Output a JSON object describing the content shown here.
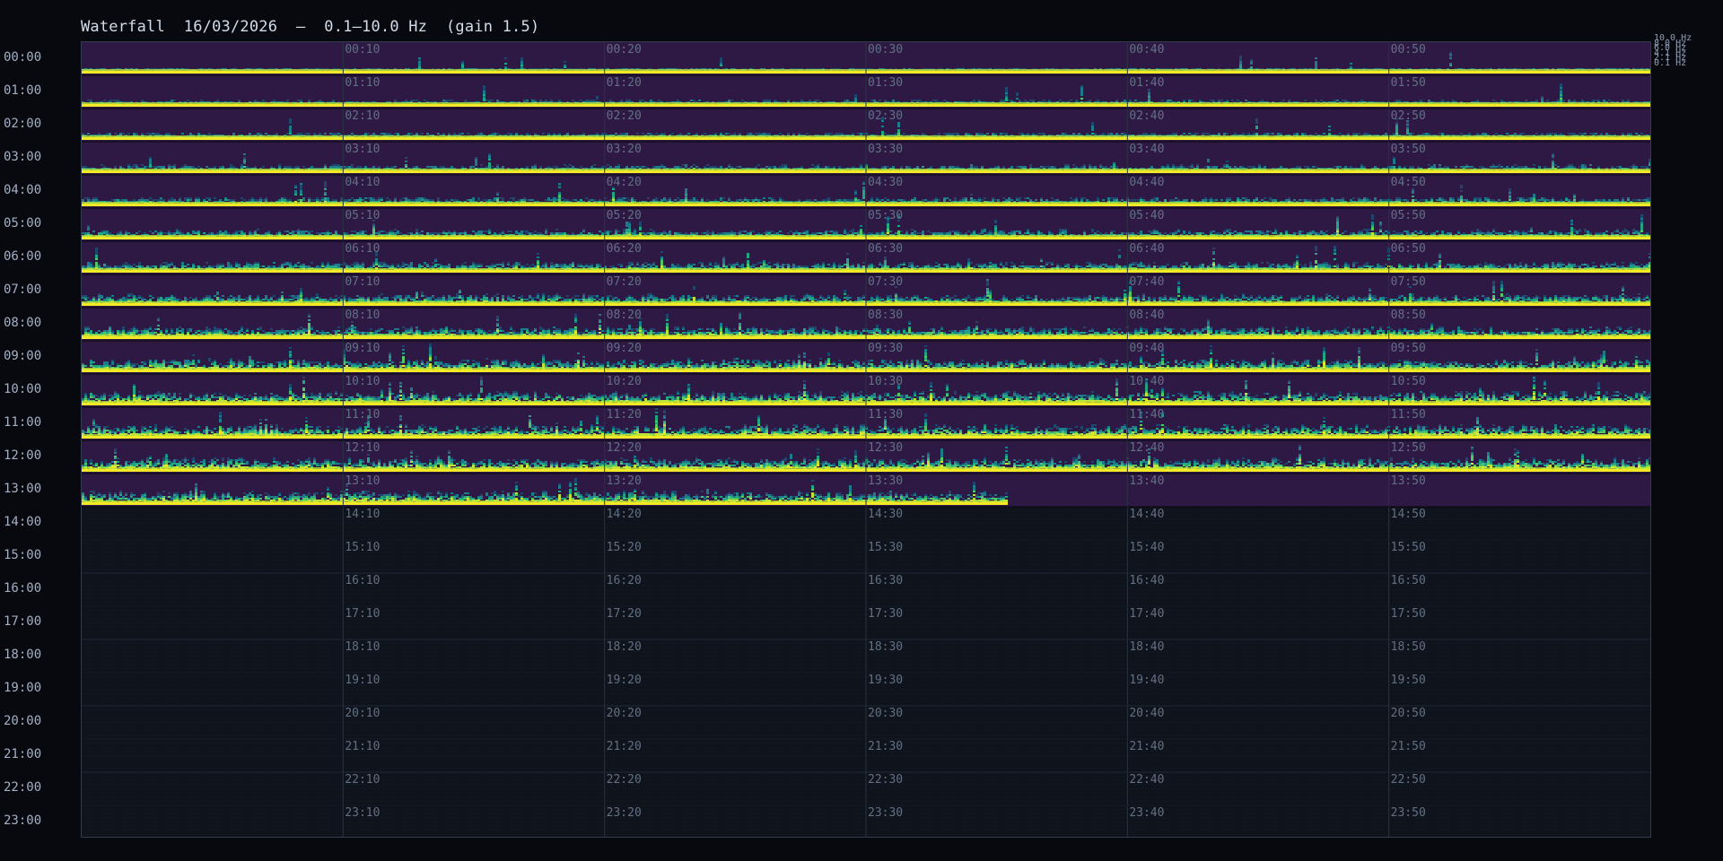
{
  "header": {
    "title": "Waterfall  16/03/2026  —  0.1–10.0 Hz  (gain 1.5)"
  },
  "freq_legend": [
    "10.0 Hz",
    "8.0 Hz",
    "6.0 Hz",
    "4.1 Hz",
    "2.1 Hz",
    "0.1 Hz"
  ],
  "hours": [
    "00:00",
    "01:00",
    "02:00",
    "03:00",
    "04:00",
    "05:00",
    "06:00",
    "07:00",
    "08:00",
    "09:00",
    "10:00",
    "11:00",
    "12:00",
    "13:00",
    "14:00",
    "15:00",
    "16:00",
    "17:00",
    "18:00",
    "19:00",
    "20:00",
    "21:00",
    "22:00",
    "23:00"
  ],
  "minute_columns": [
    "10",
    "20",
    "30",
    "40",
    "50"
  ],
  "colors": {
    "background": "#07090e",
    "row_bg": "#2e1944",
    "empty_bg": "#0f131c",
    "gridline": "#1a2230",
    "colormap": [
      "#2e1944",
      "#21466e",
      "#1c7a8a",
      "#22a583",
      "#56c565",
      "#bde33b",
      "#f3e924"
    ]
  },
  "data_fill": {
    "complete_hours": 13,
    "last_hour_fraction": 0.59
  }
}
